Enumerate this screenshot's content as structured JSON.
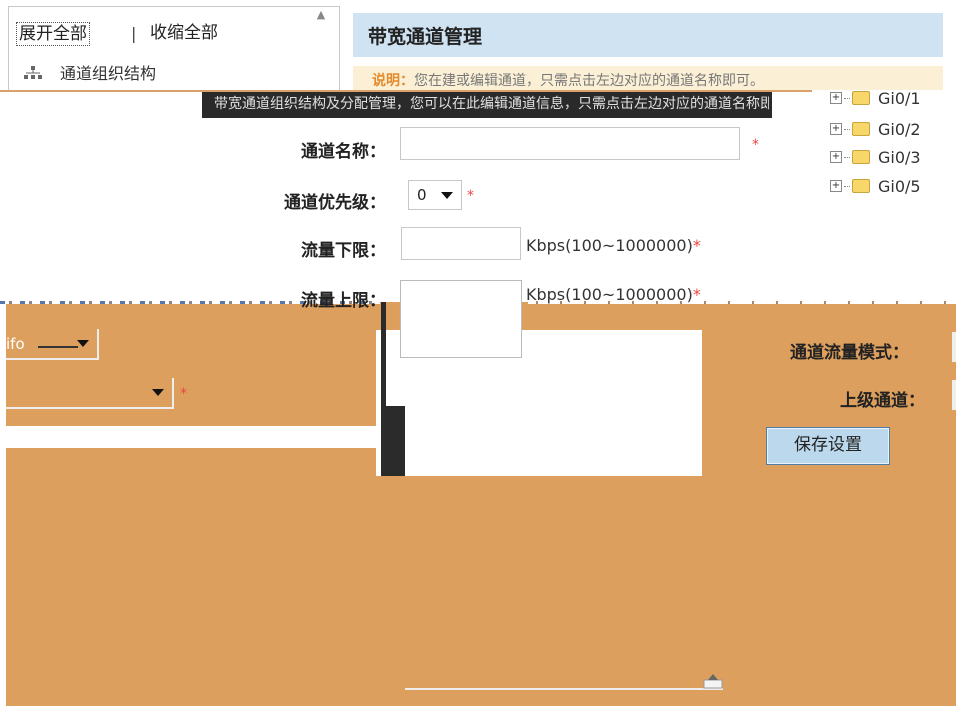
{
  "left_panel": {
    "expand_all": "展开全部",
    "divider": "|",
    "collapse_all": "收缩全部",
    "org_label": "通道组织结构"
  },
  "header": {
    "title": "带宽通道管理",
    "note_label": "说明：",
    "note_text": "您在建或编辑通道，只需点击左边对应的通道名称即可。",
    "band_text": "带宽通道组织结构及分配管理，您可以在此编辑通道信息，只需点击左边对应的通道名称即可。"
  },
  "tree": {
    "items": [
      "Gi0/1",
      "Gi0/2",
      "Gi0/3",
      "Gi0/5"
    ]
  },
  "form": {
    "name_label": "通道名称：",
    "priority_label": "通道优先级：",
    "priority_value": "0",
    "min_label": "流量下限：",
    "min_unit": "Kbps(100~1000000)",
    "max_label": "流量上限：",
    "max_unit": "Kbps(100~1000000)",
    "required_mark": "*",
    "mode_select_value": "ifo",
    "mode_label": "通道流量模式：",
    "parent_label": "上级通道：",
    "save_label": "保存设置"
  },
  "icons": {
    "org": "org-chart-icon",
    "folder": "folder-icon",
    "expand": "plus-toggle-icon",
    "caret": "chevron-down-icon",
    "resize": "resize-grip-icon"
  },
  "colors": {
    "title_bg": "#cfe3f3",
    "note_bg": "#fbf0d6",
    "orange": "#dc9f5e",
    "required": "#e44444",
    "button_bg": "#bcd8ec"
  }
}
